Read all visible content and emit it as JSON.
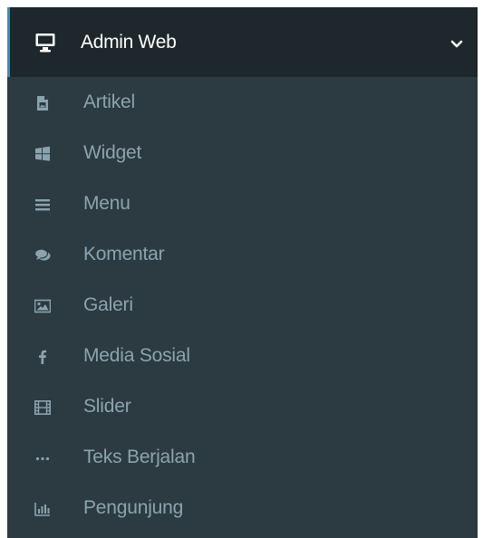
{
  "sidebar": {
    "header": {
      "icon": "desktop-icon",
      "label": "Admin Web",
      "chevron": "chevron-down-icon"
    },
    "items": [
      {
        "label": "Artikel",
        "icon": "file-image-icon"
      },
      {
        "label": "Widget",
        "icon": "windows-icon"
      },
      {
        "label": "Menu",
        "icon": "bars-icon"
      },
      {
        "label": "Komentar",
        "icon": "comments-icon"
      },
      {
        "label": "Galeri",
        "icon": "picture-icon"
      },
      {
        "label": "Media Sosial",
        "icon": "facebook-icon"
      },
      {
        "label": "Slider",
        "icon": "film-icon"
      },
      {
        "label": "Teks Berjalan",
        "icon": "ellipsis-icon"
      },
      {
        "label": "Pengunjung",
        "icon": "bar-chart-icon"
      }
    ]
  },
  "colors": {
    "sidebar_bg": "#2c3b41",
    "header_bg": "#1e282c",
    "item_text": "#8aa4af",
    "header_text": "#ffffff"
  }
}
